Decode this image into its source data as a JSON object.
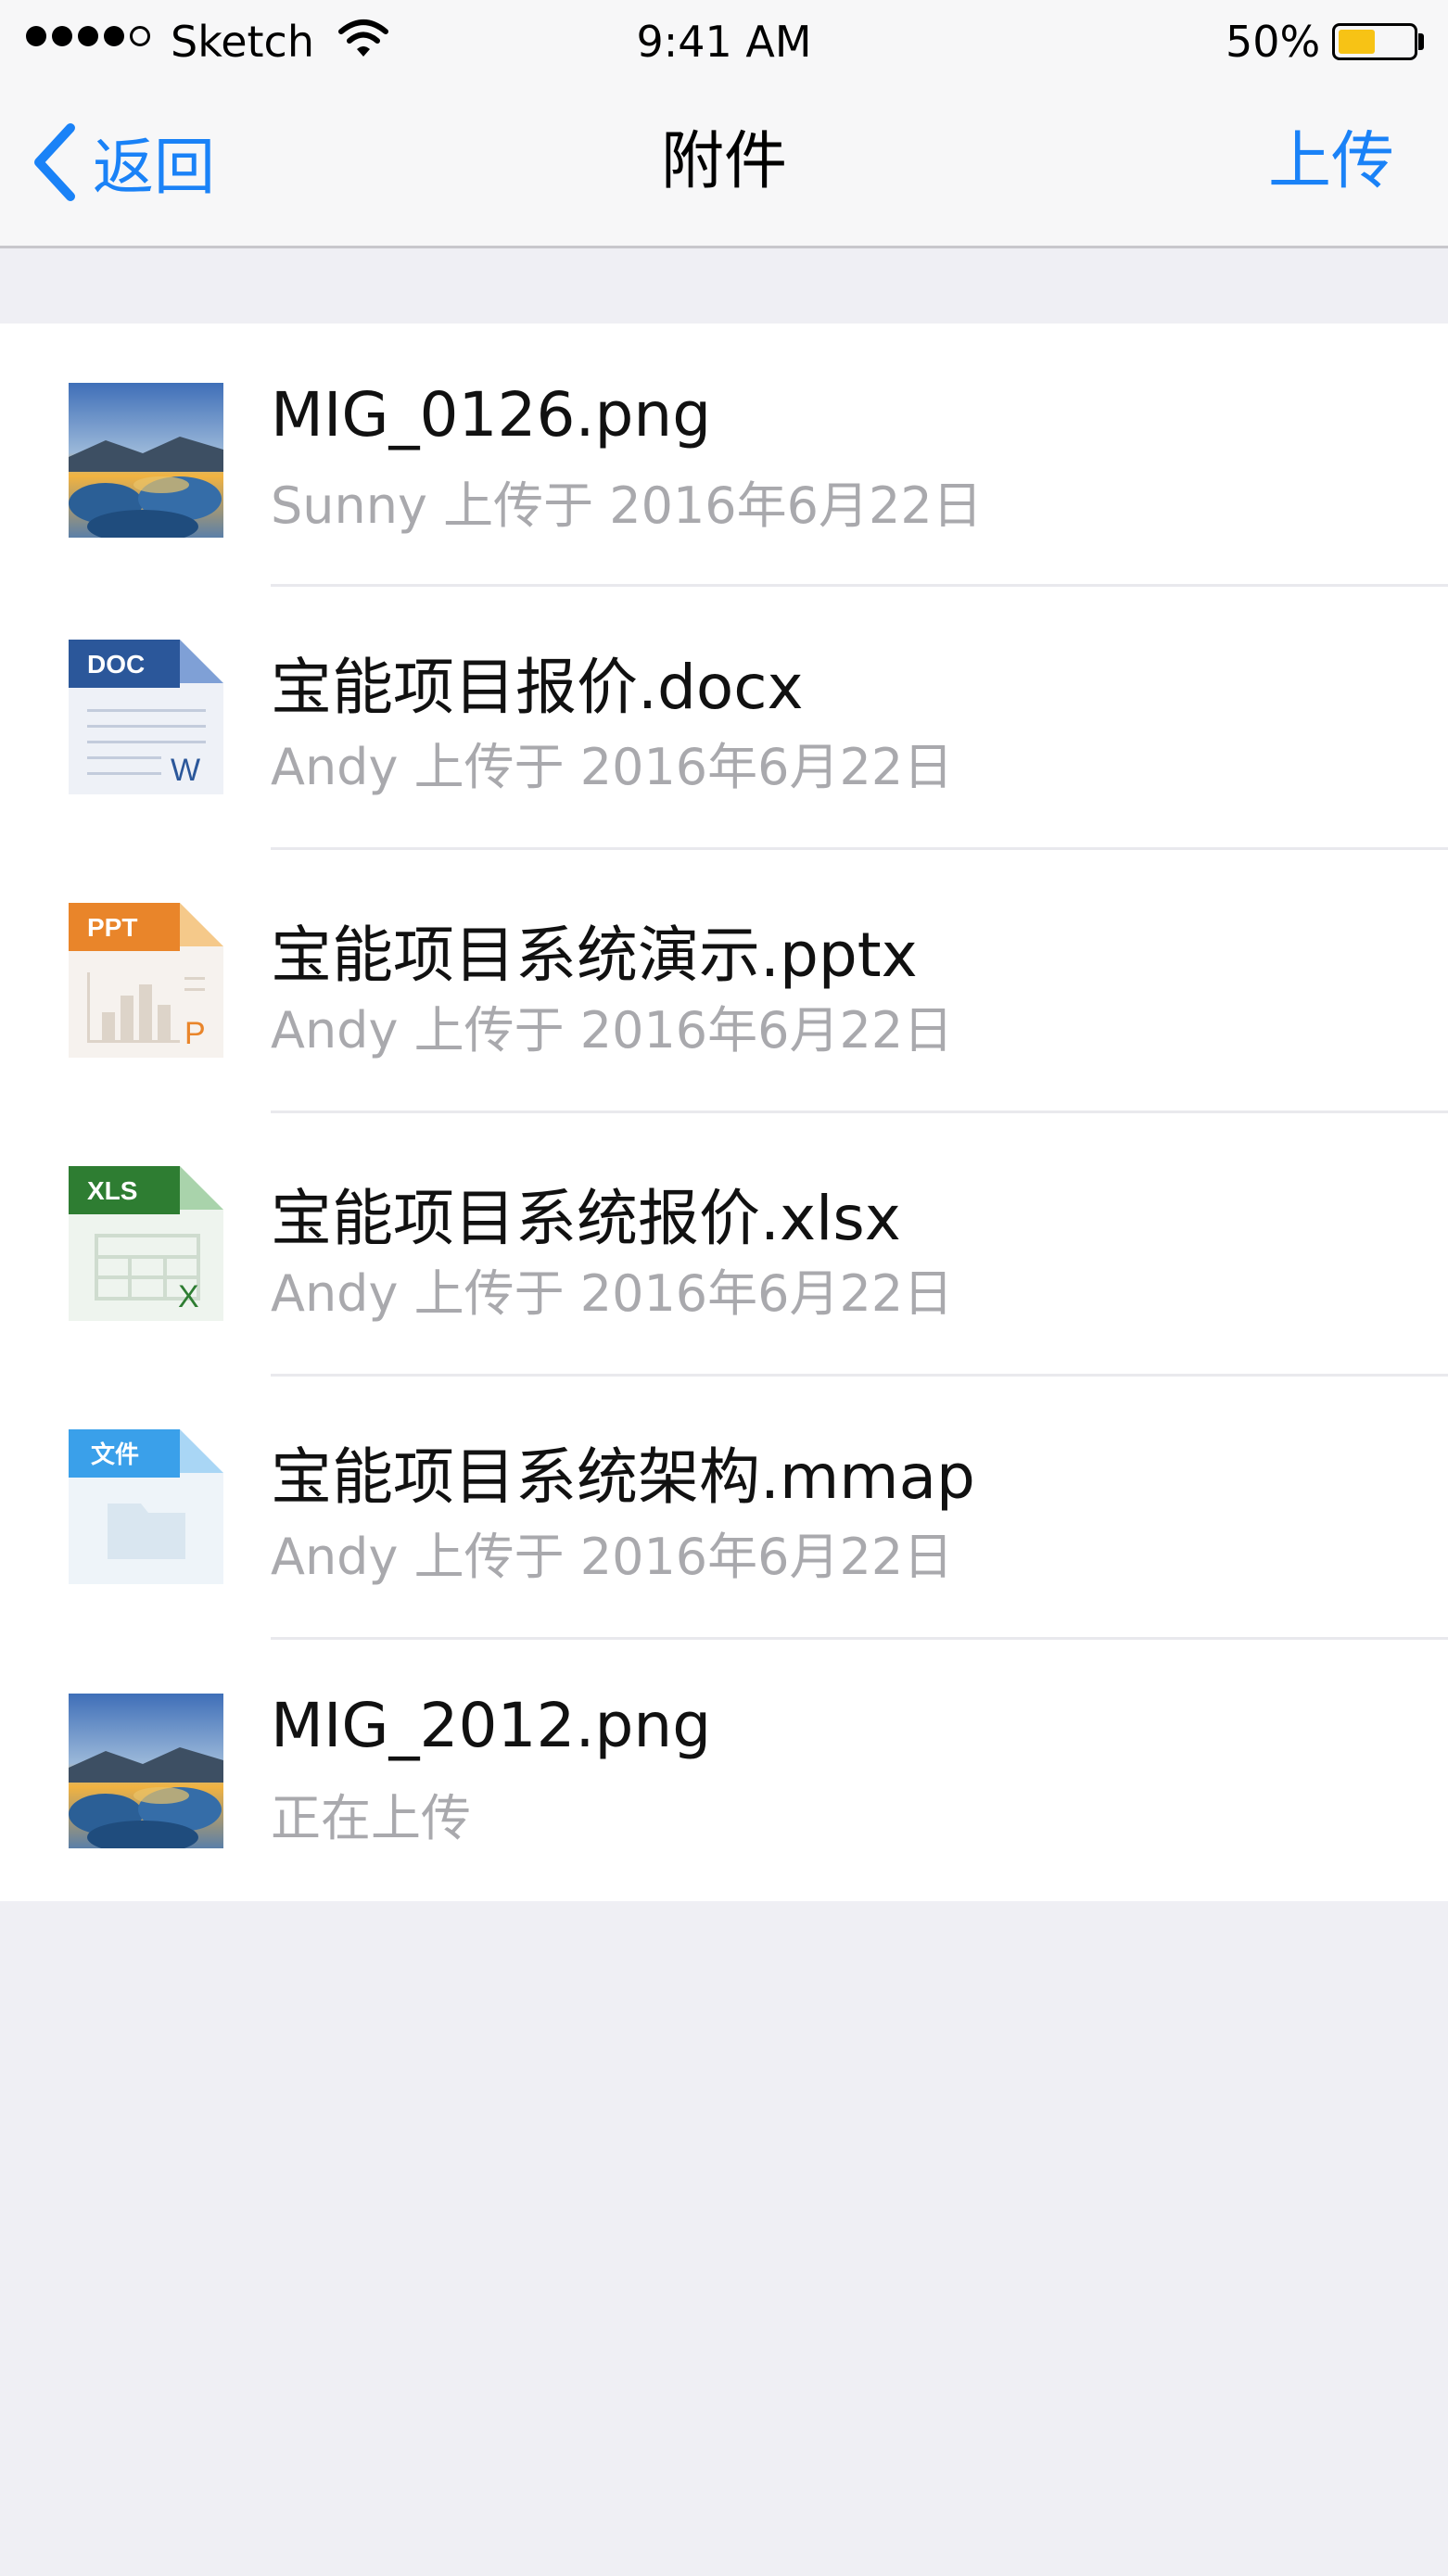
{
  "status_bar": {
    "carrier": "Sketch",
    "time": "9:41 AM",
    "battery_percent_text": "50%",
    "battery_level": 0.5
  },
  "nav": {
    "back_label": "返回",
    "title": "附件",
    "action_label": "上传"
  },
  "files": [
    {
      "name": "MIG_0126.png",
      "subtitle": "Sunny 上传于 2016年6月22日",
      "icon": "image-thumbnail-icon"
    },
    {
      "name": "宝能项目报价.docx",
      "subtitle": "Andy 上传于 2016年6月22日",
      "icon": "doc-file-icon",
      "badge": "DOC",
      "mark": "W"
    },
    {
      "name": "宝能项目系统演示.pptx",
      "subtitle": "Andy 上传于 2016年6月22日",
      "icon": "ppt-file-icon",
      "badge": "PPT",
      "mark": "P"
    },
    {
      "name": "宝能项目系统报价.xlsx",
      "subtitle": "Andy 上传于 2016年6月22日",
      "icon": "xls-file-icon",
      "badge": "XLS",
      "mark": "X"
    },
    {
      "name": "宝能项目系统架构.mmap",
      "subtitle": "Andy 上传于 2016年6月22日",
      "icon": "generic-file-icon",
      "badge": "文件"
    },
    {
      "name": "MIG_2012.png",
      "subtitle": "正在上传",
      "icon": "image-thumbnail-icon"
    }
  ],
  "colors": {
    "accent": "#1a82f7",
    "doc": "#2b579a",
    "ppt": "#e9852a",
    "xls": "#2e7d32",
    "file": "#3aa0ea",
    "battery": "#f7c315"
  }
}
